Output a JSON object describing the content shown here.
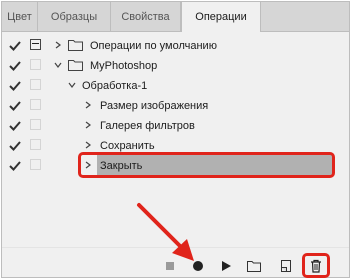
{
  "tabs": [
    {
      "label": "Цвет",
      "active": false
    },
    {
      "label": "Образцы",
      "active": false
    },
    {
      "label": "Свойства",
      "active": false
    },
    {
      "label": "Операции",
      "active": true
    }
  ],
  "actions": [
    {
      "label": "Операции по умолчанию",
      "type": "set",
      "expanded": false,
      "checked": true,
      "dialog": true
    },
    {
      "label": "MyPhotoshop",
      "type": "set",
      "expanded": true,
      "checked": true,
      "dialog": false
    },
    {
      "label": "Обработка-1",
      "type": "action",
      "expanded": true,
      "checked": true,
      "dialog": false
    },
    {
      "label": "Размер изображения",
      "type": "command",
      "expanded": false,
      "checked": true,
      "dialog": false
    },
    {
      "label": "Галерея фильтров",
      "type": "command",
      "expanded": false,
      "checked": true,
      "dialog": false
    },
    {
      "label": "Сохранить",
      "type": "command",
      "expanded": false,
      "checked": true,
      "dialog": false
    },
    {
      "label": "Закрыть",
      "type": "command",
      "expanded": false,
      "checked": true,
      "dialog": false,
      "selected": true
    }
  ],
  "toolbar": {
    "buttons": [
      "stop-icon",
      "record-icon",
      "play-icon",
      "new-set-folder-icon",
      "new-action-icon",
      "trash-icon"
    ]
  },
  "colors": {
    "highlight": "#e0241b",
    "selected_row": "#b1b1b1",
    "panel_bg": "#f0f0f0",
    "tab_bg": "#d6d6d6"
  }
}
